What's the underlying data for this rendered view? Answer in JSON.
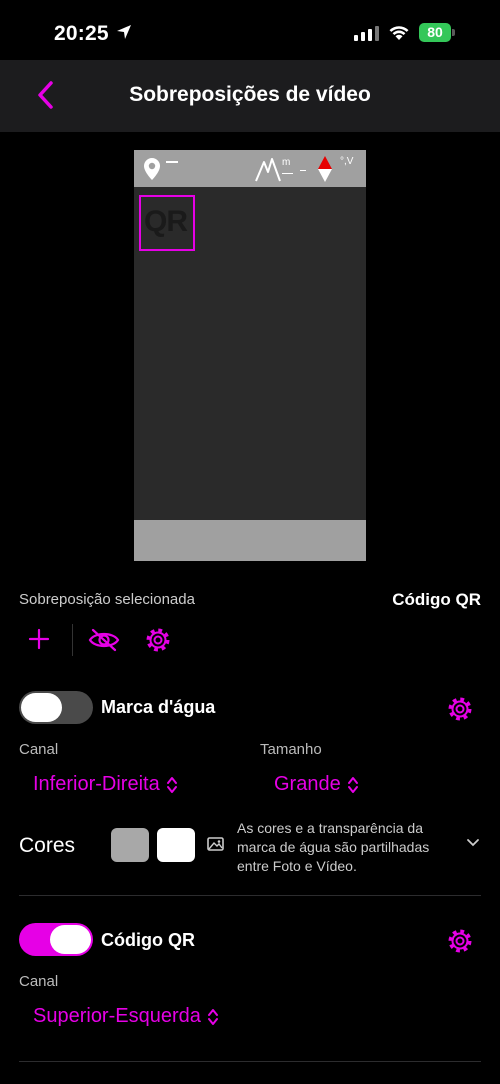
{
  "status": {
    "time": "20:25",
    "battery": "80"
  },
  "nav": {
    "title": "Sobreposições de vídeo"
  },
  "preview": {
    "qr_text": "QR",
    "altitude_unit": "m",
    "speed_unit": "°,V"
  },
  "selected": {
    "label": "Sobreposição selecionada",
    "value": "Código QR"
  },
  "watermark": {
    "label": "Marca d'água",
    "enabled": false,
    "channel_label": "Canal",
    "channel_value": "Inferior-Direita",
    "size_label": "Tamanho",
    "size_value": "Grande",
    "colors_label": "Cores",
    "colors": [
      "#a8a8a8",
      "#ffffff"
    ],
    "note": "As cores e a transparência da marca de água são partilhadas entre Foto e Vídeo."
  },
  "qr": {
    "label": "Código QR",
    "enabled": true,
    "channel_label": "Canal",
    "channel_value": "Superior-Esquerda"
  },
  "colors": {
    "accent": "#e600e6",
    "background": "#000000",
    "nav": "#1c1c1e"
  }
}
